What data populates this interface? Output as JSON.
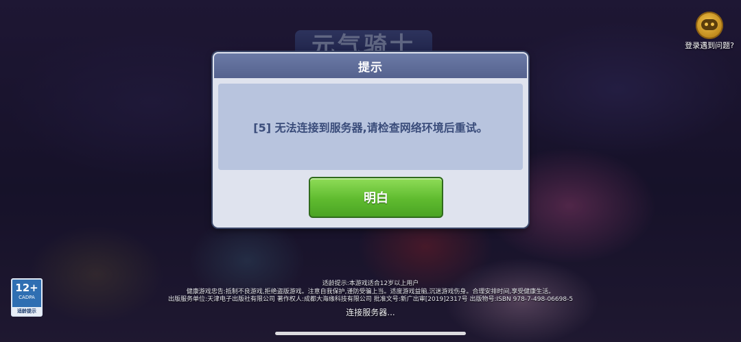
{
  "background": {
    "logo_text": "元气骑士"
  },
  "help": {
    "icon": "help-face-icon",
    "label": "登录遇到问题?"
  },
  "dialog": {
    "title": "提示",
    "message": "[5] 无法连接到服务器,请检查网络环境后重试。",
    "ok_label": "明白",
    "colors": {
      "header": "#5f6c98",
      "message_bg": "#b8c4de",
      "button": "#5fbb2f"
    }
  },
  "age_rating": {
    "number": "12+",
    "org": "CADPA",
    "tip": "适龄提示"
  },
  "footer": {
    "lines": [
      "适龄提示:本游戏适合12岁以上用户",
      "健康游戏忠告:抵制不良游戏,拒绝盗版游戏。注意自我保护,谨防受骗上当。适度游戏益脑,沉迷游戏伤身。合理安排时间,享受健康生活。",
      "出版服务单位:天津电子出版社有限公司 著作权人:成都大海缘科技有限公司 批准文号:新广出审[2019]2317号 出版物号:ISBN 978-7-498-06698-5"
    ],
    "status": "连接服务器..."
  }
}
